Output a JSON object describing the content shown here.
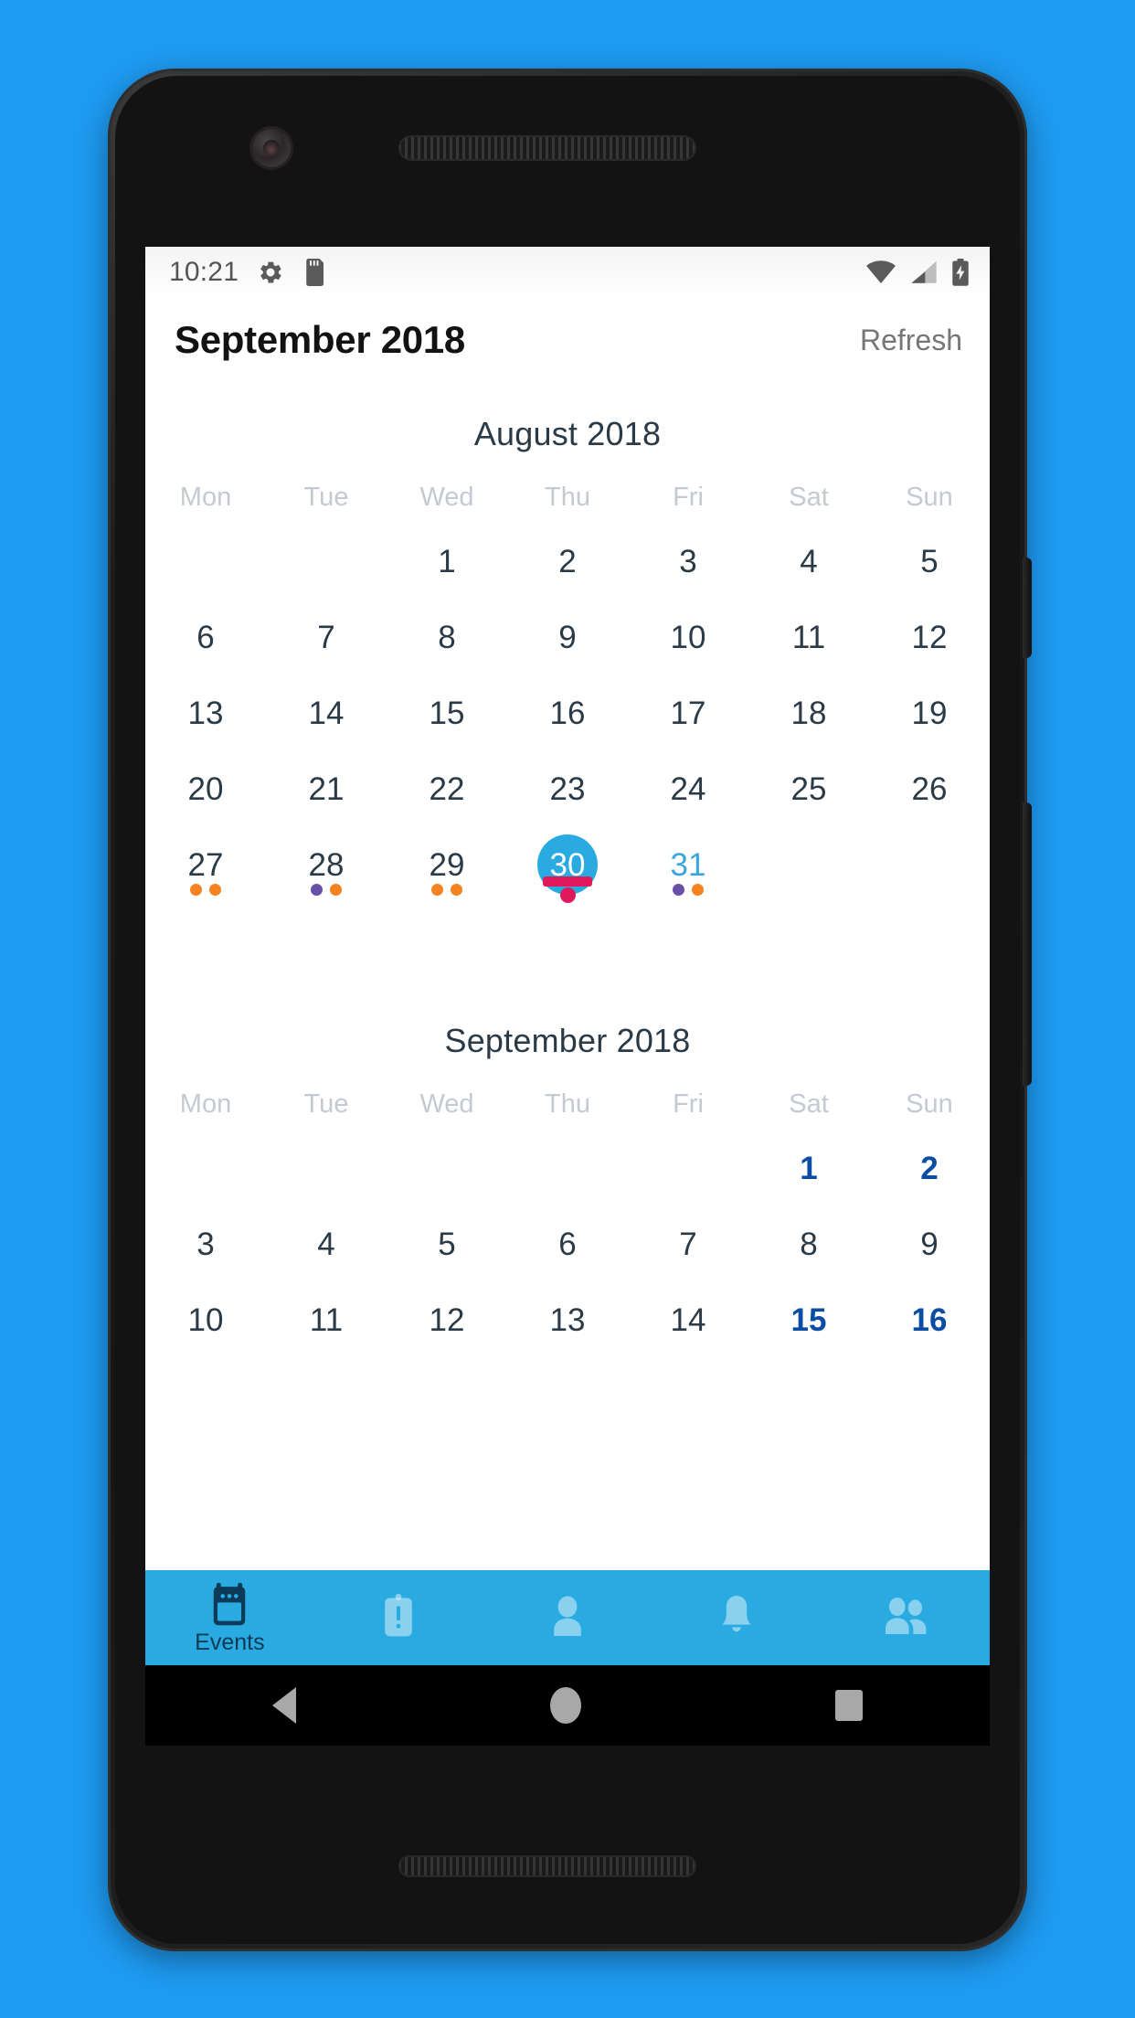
{
  "device": {
    "camera_icon": "camera-icon",
    "earpiece_icon": "earpiece-speaker",
    "bottom_speaker_icon": "bottom-speaker"
  },
  "statusbar": {
    "time": "10:21",
    "left_icons": [
      "gear-icon",
      "sd-card-icon"
    ],
    "right_icons": [
      "wifi-icon",
      "cell-signal-icon",
      "battery-charging-icon"
    ]
  },
  "appbar": {
    "title": "September 2018",
    "refresh_label": "Refresh"
  },
  "weekday_headers": [
    "Mon",
    "Tue",
    "Wed",
    "Thu",
    "Fri",
    "Sat",
    "Sun"
  ],
  "colors": {
    "accent_blue": "#29abe2",
    "weekend_blue": "#0b4da2",
    "next_month_blue": "#3aa6de",
    "day_text": "#2b3a47",
    "weekday_header": "#c4c9d2",
    "dot_orange": "#f58220",
    "dot_purple": "#6a4fa8",
    "marker_crimson": "#e0185c",
    "navbar": "#29abe2",
    "background_blue": "#1e9bf2"
  },
  "months": [
    {
      "title": "August 2018",
      "weeks": [
        [
          {
            "label": "",
            "style": "empty",
            "dots": []
          },
          {
            "label": "",
            "style": "empty",
            "dots": []
          },
          {
            "label": "1",
            "style": "normal",
            "dots": []
          },
          {
            "label": "2",
            "style": "normal",
            "dots": []
          },
          {
            "label": "3",
            "style": "normal",
            "dots": []
          },
          {
            "label": "4",
            "style": "normal",
            "dots": []
          },
          {
            "label": "5",
            "style": "normal",
            "dots": []
          }
        ],
        [
          {
            "label": "6",
            "style": "normal",
            "dots": []
          },
          {
            "label": "7",
            "style": "normal",
            "dots": []
          },
          {
            "label": "8",
            "style": "normal",
            "dots": []
          },
          {
            "label": "9",
            "style": "normal",
            "dots": []
          },
          {
            "label": "10",
            "style": "normal",
            "dots": []
          },
          {
            "label": "11",
            "style": "normal",
            "dots": []
          },
          {
            "label": "12",
            "style": "normal",
            "dots": []
          }
        ],
        [
          {
            "label": "13",
            "style": "normal",
            "dots": []
          },
          {
            "label": "14",
            "style": "normal",
            "dots": []
          },
          {
            "label": "15",
            "style": "normal",
            "dots": []
          },
          {
            "label": "16",
            "style": "normal",
            "dots": []
          },
          {
            "label": "17",
            "style": "normal",
            "dots": []
          },
          {
            "label": "18",
            "style": "normal",
            "dots": []
          },
          {
            "label": "19",
            "style": "normal",
            "dots": []
          }
        ],
        [
          {
            "label": "20",
            "style": "normal",
            "dots": []
          },
          {
            "label": "21",
            "style": "normal",
            "dots": []
          },
          {
            "label": "22",
            "style": "normal",
            "dots": []
          },
          {
            "label": "23",
            "style": "normal",
            "dots": []
          },
          {
            "label": "24",
            "style": "normal",
            "dots": []
          },
          {
            "label": "25",
            "style": "normal",
            "dots": []
          },
          {
            "label": "26",
            "style": "normal",
            "dots": []
          }
        ],
        [
          {
            "label": "27",
            "style": "normal",
            "dots": [
              "orange",
              "orange"
            ]
          },
          {
            "label": "28",
            "style": "normal",
            "dots": [
              "purple",
              "orange"
            ]
          },
          {
            "label": "29",
            "style": "normal",
            "dots": [
              "orange",
              "orange"
            ]
          },
          {
            "label": "30",
            "style": "selected",
            "dots": [],
            "markers": [
              "bar",
              "dot"
            ]
          },
          {
            "label": "31",
            "style": "nextmonth-blue",
            "dots": [
              "purple",
              "orange"
            ]
          },
          {
            "label": "",
            "style": "empty",
            "dots": []
          },
          {
            "label": "",
            "style": "empty",
            "dots": []
          }
        ]
      ]
    },
    {
      "title": "September 2018",
      "weeks": [
        [
          {
            "label": "",
            "style": "empty",
            "dots": []
          },
          {
            "label": "",
            "style": "empty",
            "dots": []
          },
          {
            "label": "",
            "style": "empty",
            "dots": []
          },
          {
            "label": "",
            "style": "empty",
            "dots": []
          },
          {
            "label": "",
            "style": "empty",
            "dots": []
          },
          {
            "label": "1",
            "style": "weekend",
            "dots": []
          },
          {
            "label": "2",
            "style": "weekend",
            "dots": []
          }
        ],
        [
          {
            "label": "3",
            "style": "normal",
            "dots": []
          },
          {
            "label": "4",
            "style": "normal",
            "dots": []
          },
          {
            "label": "5",
            "style": "normal",
            "dots": []
          },
          {
            "label": "6",
            "style": "normal",
            "dots": []
          },
          {
            "label": "7",
            "style": "normal",
            "dots": []
          },
          {
            "label": "8",
            "style": "normal",
            "dots": []
          },
          {
            "label": "9",
            "style": "normal",
            "dots": []
          }
        ],
        [
          {
            "label": "10",
            "style": "normal",
            "dots": []
          },
          {
            "label": "11",
            "style": "normal",
            "dots": []
          },
          {
            "label": "12",
            "style": "normal",
            "dots": []
          },
          {
            "label": "13",
            "style": "normal",
            "dots": []
          },
          {
            "label": "14",
            "style": "normal",
            "dots": []
          },
          {
            "label": "15",
            "style": "weekend",
            "dots": []
          },
          {
            "label": "16",
            "style": "weekend",
            "dots": []
          }
        ]
      ]
    }
  ],
  "bottomnav": {
    "items": [
      {
        "icon": "calendar-icon",
        "label": "Events",
        "active": true
      },
      {
        "icon": "clipboard-icon",
        "label": "",
        "active": false
      },
      {
        "icon": "person-icon",
        "label": "",
        "active": false
      },
      {
        "icon": "bell-icon",
        "label": "",
        "active": false
      },
      {
        "icon": "people-icon",
        "label": "",
        "active": false
      }
    ]
  },
  "sysnav": {
    "back_icon": "back-triangle-icon",
    "home_icon": "home-circle-icon",
    "recents_icon": "recents-square-icon"
  }
}
